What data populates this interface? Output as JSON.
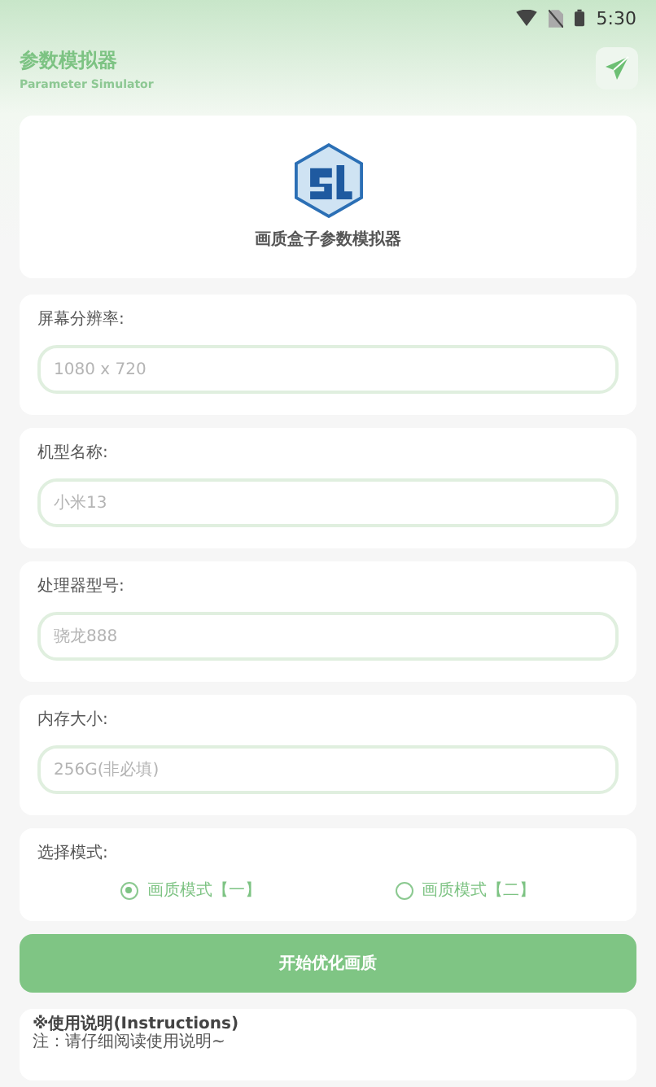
{
  "status_bar": {
    "time": "5:30"
  },
  "header": {
    "title": "参数模拟器",
    "subtitle": "Parameter Simulator"
  },
  "logo": {
    "caption": "画质盒子参数模拟器"
  },
  "fields": [
    {
      "label": "屏幕分辨率:",
      "placeholder": "1080 x 720"
    },
    {
      "label": "机型名称:",
      "placeholder": "小米13"
    },
    {
      "label": "处理器型号:",
      "placeholder": "骁龙888"
    },
    {
      "label": "内存大小:",
      "placeholder": "256G(非必填)"
    }
  ],
  "mode": {
    "label": "选择模式:",
    "options": [
      {
        "label": "画质模式【一】",
        "selected": true
      },
      {
        "label": "画质模式【二】",
        "selected": false
      }
    ]
  },
  "start_button": "开始优化画质",
  "instructions": {
    "title": "※使用说明(Instructions)",
    "note": "注：请仔细阅读使用说明~"
  }
}
